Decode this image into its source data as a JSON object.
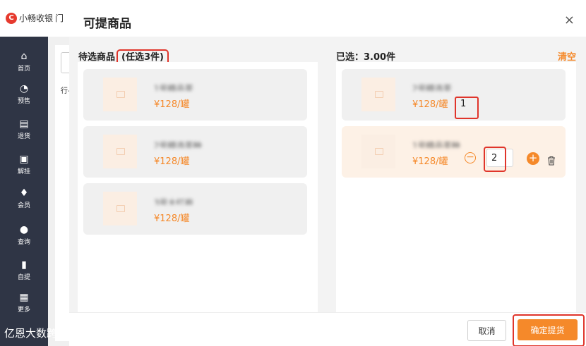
{
  "app": {
    "brand": "小畅收银",
    "brand_suffix": "门",
    "sidebar": [
      {
        "label": "首页",
        "icon": "home-icon",
        "glyph": "⌂"
      },
      {
        "label": "预售",
        "icon": "clock-icon",
        "glyph": "◔"
      },
      {
        "label": "退货",
        "icon": "return-icon",
        "glyph": "▤"
      },
      {
        "label": "解挂",
        "icon": "unhold-icon",
        "glyph": "▣"
      },
      {
        "label": "会员",
        "icon": "member-icon",
        "glyph": "♦"
      },
      {
        "label": "查询",
        "icon": "search-icon",
        "glyph": "●"
      },
      {
        "label": "自提",
        "icon": "pickup-bag-icon",
        "glyph": "▮"
      },
      {
        "label": "更多",
        "icon": "grid-icon",
        "glyph": "▦"
      }
    ],
    "card_text": "行-"
  },
  "dialog": {
    "title": "可提商品",
    "close_symbol": "×",
    "left": {
      "heading": "待选商品",
      "hint": "(任选3件)",
      "products": [
        {
          "name": "1号精品茶",
          "price": "¥128/罐"
        },
        {
          "name": "2号精选茶种",
          "price": "¥128/罐"
        },
        {
          "name": "3号大红袍",
          "price": "¥128/罐"
        }
      ]
    },
    "right": {
      "heading": "已选：3.00件",
      "clear_label": "清空",
      "products": [
        {
          "name": "2号精选茶",
          "price": "¥128/罐",
          "qty": "1"
        },
        {
          "name": "1号精品茶种",
          "price": "¥128/罐",
          "qty": "2"
        }
      ]
    },
    "footer": {
      "cancel_label": "取消",
      "confirm_label": "确定提货"
    }
  },
  "watermark": "亿恩大数跨境",
  "colors": {
    "accent": "#f5892a",
    "highlight": "#e0352b",
    "sidebar_bg": "#2f3545"
  }
}
